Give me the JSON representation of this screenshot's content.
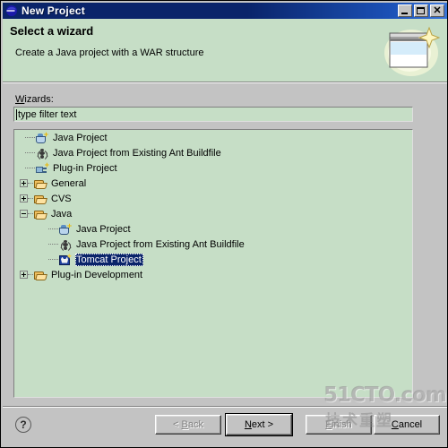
{
  "window": {
    "title": "New Project",
    "icon": "eclipse-icon",
    "controls": {
      "minimize": "minimize-button",
      "maximize": "maximize-button",
      "close_label": "✕"
    }
  },
  "header": {
    "title": "Select a wizard",
    "description": "Create a Java project with a WAR structure",
    "banner_icon": "new-project-wizard-banner-icon",
    "background_color": "#c6dec6"
  },
  "form": {
    "wizards_label_mnemonic": "W",
    "wizards_label_rest": "izards:",
    "filter": {
      "value": "type filter text",
      "placeholder": "type filter text"
    }
  },
  "tree": {
    "items": [
      {
        "label": "Java Project",
        "icon": "java-project-icon",
        "indent": 0,
        "expander": "none",
        "selected": false
      },
      {
        "label": "Java Project from Existing Ant Buildfile",
        "icon": "ant-buildfile-icon",
        "indent": 0,
        "expander": "none",
        "selected": false
      },
      {
        "label": "Plug-in Project",
        "icon": "plugin-project-icon",
        "indent": 0,
        "expander": "none",
        "selected": false
      },
      {
        "label": "General",
        "icon": "folder-icon",
        "indent": 0,
        "expander": "plus",
        "selected": false
      },
      {
        "label": "CVS",
        "icon": "folder-icon",
        "indent": 0,
        "expander": "plus",
        "selected": false
      },
      {
        "label": "Java",
        "icon": "folder-icon",
        "indent": 0,
        "expander": "minus",
        "selected": false
      },
      {
        "label": "Java Project",
        "icon": "java-project-icon",
        "indent": 1,
        "expander": "none",
        "selected": false
      },
      {
        "label": "Java Project from Existing Ant Buildfile",
        "icon": "ant-buildfile-icon",
        "indent": 1,
        "expander": "none",
        "selected": false
      },
      {
        "label": "Tomcat Project",
        "icon": "tomcat-project-icon",
        "indent": 1,
        "expander": "none",
        "selected": true
      },
      {
        "label": "Plug-in Development",
        "icon": "folder-icon",
        "indent": 0,
        "expander": "plus",
        "selected": false
      }
    ],
    "selection_color": "#0a246a",
    "background_color": "#c6dec6"
  },
  "buttons": {
    "help": "?",
    "back": {
      "label": "< Back",
      "mnemonic": "B",
      "pre": "< ",
      "post": "ack",
      "disabled": true
    },
    "next": {
      "label": "Next >",
      "mnemonic": "N",
      "pre": "",
      "post": "ext >",
      "disabled": false,
      "is_default": true
    },
    "finish": {
      "label": "Finish",
      "mnemonic": "F",
      "pre": "",
      "post": "inish",
      "disabled": true
    },
    "cancel": {
      "label": "Cancel",
      "mnemonic": "C",
      "pre": "",
      "post": "ancel",
      "disabled": false
    }
  },
  "watermark": {
    "main": "51CTO.com",
    "sub": "技术重塑"
  }
}
